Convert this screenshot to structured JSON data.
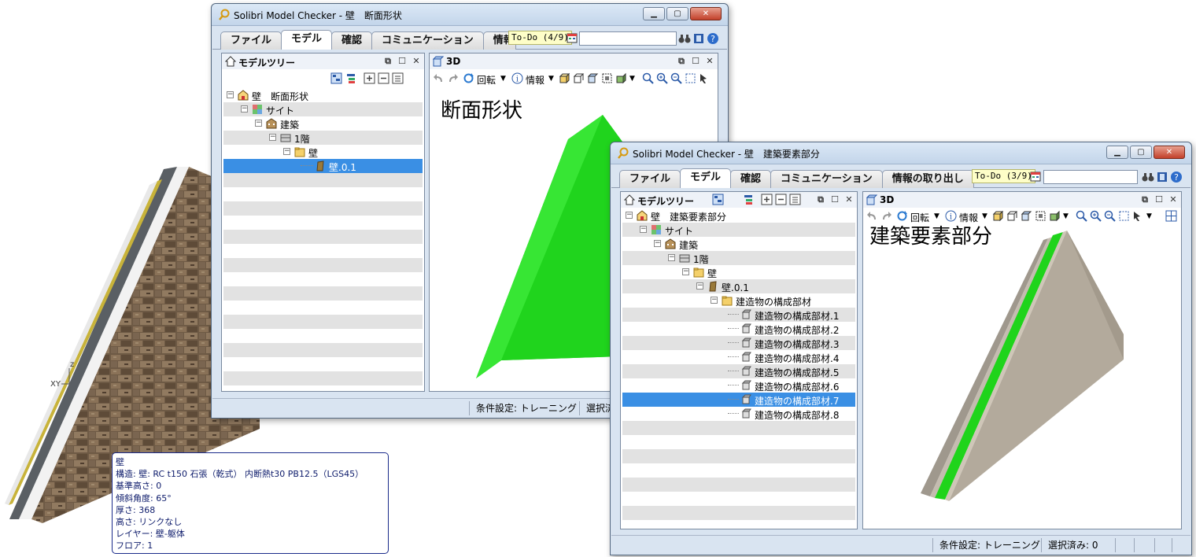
{
  "colors": {
    "accent": "#3a8fe4",
    "wall_green": "#23e021",
    "wall_gray": "#b2a898",
    "todo_bg": "#fefec8"
  },
  "background": {
    "axis_labels": {
      "z": "z",
      "xy": "XY"
    },
    "tooltip": {
      "title": "壁",
      "lines": [
        "構造: 壁: RC t150 石張（乾式） 内断熱t30 PB12.5（LGS45）",
        "基準高さ: 0",
        "傾斜角度: 65°",
        "厚さ: 368",
        "高さ: リンクなし",
        "レイヤー: 壁-躯体",
        "フロア: 1"
      ]
    }
  },
  "window1": {
    "title": "Solibri Model Checker - 壁　断面形状",
    "caption_buttons": [
      "minimize-icon",
      "maximize-icon",
      "close-icon"
    ],
    "tabs": [
      "ファイル",
      "モデル",
      "確認",
      "コミュニケーション",
      "情報"
    ],
    "active_tab": "モデル",
    "todo": "To-Do (4/9)",
    "search_value": "",
    "model_tree": {
      "title": "モデルツリー",
      "rows": [
        {
          "label": "壁　断面形状",
          "icon": "model-icon"
        },
        {
          "label": "サイト",
          "icon": "site-icon"
        },
        {
          "label": "建築",
          "icon": "building-icon"
        },
        {
          "label": "1階",
          "icon": "storey-icon"
        },
        {
          "label": "壁",
          "icon": "folder-icon"
        },
        {
          "label": "壁.0.1",
          "icon": "wall-icon"
        }
      ]
    },
    "view3d": {
      "title": "3D",
      "rotate_label": "回転",
      "info_label": "情報",
      "heading": "断面形状"
    },
    "status": {
      "condition": "条件設定: トレーニング",
      "selected": "選択済"
    }
  },
  "window2": {
    "title": "Solibri Model Checker - 壁　建築要素部分",
    "caption_buttons": [
      "minimize-icon",
      "maximize-icon",
      "close-icon"
    ],
    "tabs": [
      "ファイル",
      "モデル",
      "確認",
      "コミュニケーション",
      "情報の取り出し"
    ],
    "active_tab": "モデル",
    "todo": "To-Do (3/9)",
    "search_value": "",
    "model_tree": {
      "title": "モデルツリー",
      "rows": [
        {
          "label": "壁　建築要素部分",
          "icon": "model-icon"
        },
        {
          "label": "サイト",
          "icon": "site-icon"
        },
        {
          "label": "建築",
          "icon": "building-icon"
        },
        {
          "label": "1階",
          "icon": "storey-icon"
        },
        {
          "label": "壁",
          "icon": "folder-icon"
        },
        {
          "label": "壁.0.1",
          "icon": "wall-icon"
        },
        {
          "label": "建造物の構成部材",
          "icon": "folder-icon"
        },
        {
          "label": "建造物の構成部材.1",
          "icon": "element-icon"
        },
        {
          "label": "建造物の構成部材.2",
          "icon": "element-icon"
        },
        {
          "label": "建造物の構成部材.3",
          "icon": "element-icon"
        },
        {
          "label": "建造物の構成部材.4",
          "icon": "element-icon"
        },
        {
          "label": "建造物の構成部材.5",
          "icon": "element-icon"
        },
        {
          "label": "建造物の構成部材.6",
          "icon": "element-icon"
        },
        {
          "label": "建造物の構成部材.7",
          "icon": "element-icon"
        },
        {
          "label": "建造物の構成部材.8",
          "icon": "element-icon"
        }
      ]
    },
    "view3d": {
      "title": "3D",
      "rotate_label": "回転",
      "info_label": "情報",
      "heading": "建築要素部分"
    },
    "status": {
      "condition": "条件設定: トレーニング",
      "selected": "選択済み: 0"
    }
  }
}
